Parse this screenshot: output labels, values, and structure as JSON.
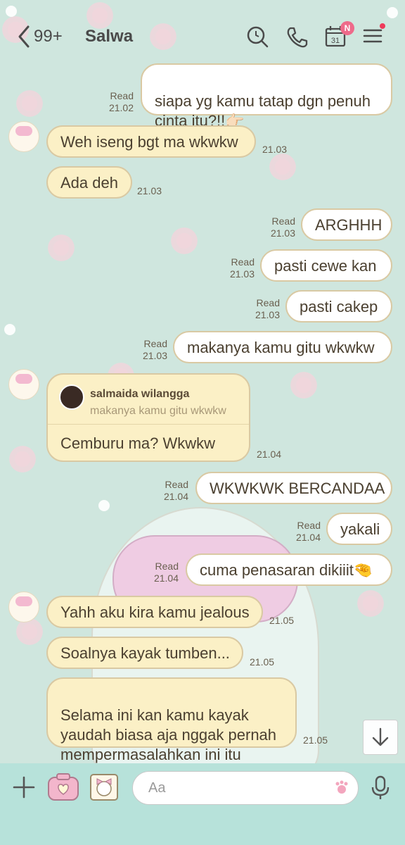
{
  "header": {
    "back_count": "99+",
    "chat_name": "Salwa",
    "calendar_day": "31",
    "badge": "N"
  },
  "messages": [
    {
      "dir": "out",
      "text": "siapa yg kamu tatap dgn penuh\ncinta itu?!!👉🏻",
      "read": "Read",
      "time": "21.02"
    },
    {
      "dir": "in",
      "text": "Weh iseng bgt ma wkwkw",
      "time": "21.03"
    },
    {
      "dir": "in",
      "text": "Ada deh",
      "time": "21.03"
    },
    {
      "dir": "out",
      "text": "ARGHHH",
      "read": "Read",
      "time": "21.03"
    },
    {
      "dir": "out",
      "text": "pasti cewe kan",
      "read": "Read",
      "time": "21.03"
    },
    {
      "dir": "out",
      "text": "pasti cakep",
      "read": "Read",
      "time": "21.03"
    },
    {
      "dir": "out",
      "text": "makanya kamu gitu wkwkw",
      "read": "Read",
      "time": "21.03"
    },
    {
      "dir": "in",
      "reply_name": "salmaida wilangga",
      "reply_text": "makanya kamu gitu wkwkw",
      "text": "Cemburu ma? Wkwkw",
      "time": "21.04"
    },
    {
      "dir": "out",
      "text": "WKWKWK BERCANDAA",
      "read": "Read",
      "time": "21.04"
    },
    {
      "dir": "out",
      "text": "yakali",
      "read": "Read",
      "time": "21.04"
    },
    {
      "dir": "out",
      "text": "cuma penasaran dikiiit🤏",
      "read": "Read",
      "time": "21.04"
    },
    {
      "dir": "in",
      "text": "Yahh aku kira kamu jealous",
      "time": "21.05"
    },
    {
      "dir": "in",
      "text": "Soalnya kayak tumben...",
      "time": "21.05"
    },
    {
      "dir": "in",
      "text": "Selama ini kan kamu kayak\nyaudah biasa aja nggak pernah\nmempermasalahkan ini itu",
      "time": "21.05"
    }
  ],
  "composer": {
    "placeholder": "Aa"
  },
  "colors": {
    "background": "#cfe6de",
    "incoming_bubble": "#fbf0c6",
    "outgoing_bubble": "#ffffff",
    "bubble_border": "#d9c9a3",
    "composer_bar": "#b7e2da",
    "badge": "#ee6a8a"
  },
  "icons": [
    "back-chevron-icon",
    "search-icon",
    "phone-icon",
    "calendar-icon",
    "menu-icon",
    "plus-icon",
    "camera-icon",
    "sticker-icon",
    "emoji-icon",
    "microphone-icon",
    "scroll-down-icon"
  ]
}
